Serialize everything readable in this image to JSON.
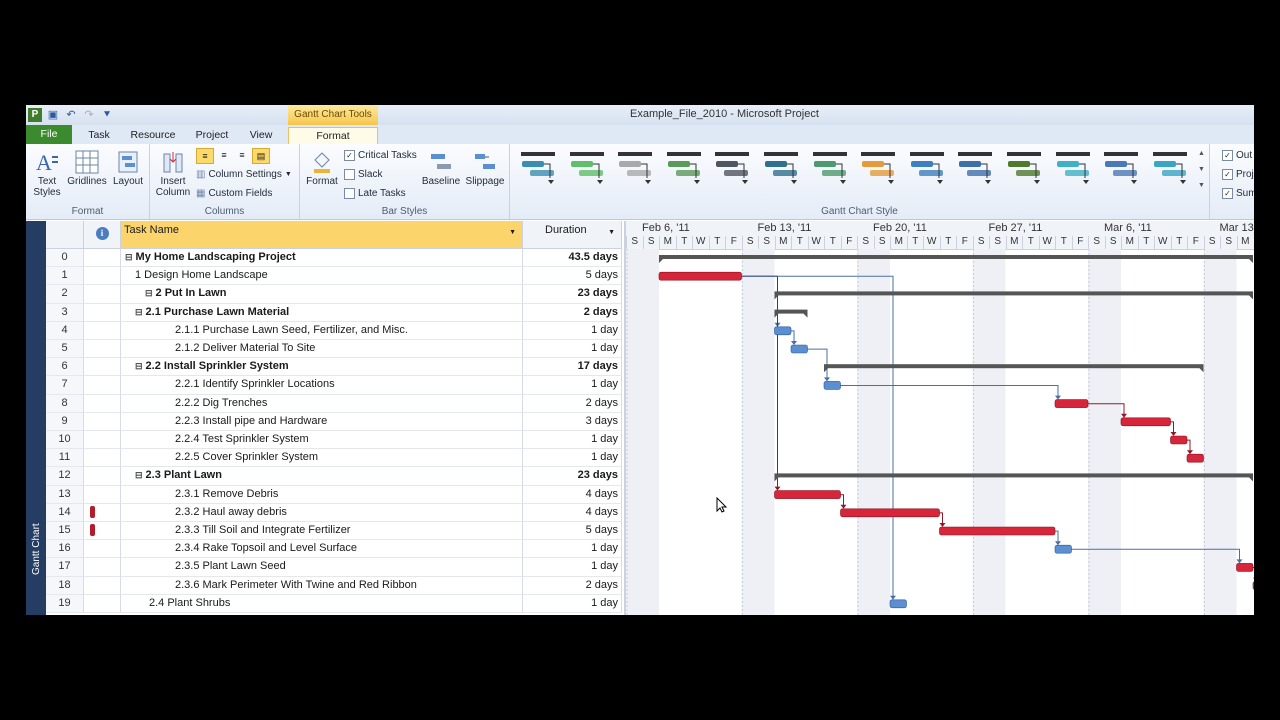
{
  "window": {
    "title": "Example_File_2010  -  Microsoft Project",
    "context_tab_title": "Gantt Chart Tools"
  },
  "quick_access": {
    "logo": "P",
    "icons": [
      "save-icon",
      "undo-icon",
      "redo-icon",
      "customize-icon"
    ]
  },
  "tabs": [
    {
      "label": "File"
    },
    {
      "label": "Task"
    },
    {
      "label": "Resource"
    },
    {
      "label": "Project"
    },
    {
      "label": "View"
    },
    {
      "label": "Format"
    }
  ],
  "ribbon": {
    "format_group": {
      "label": "Format",
      "text_styles": "Text\nStyles",
      "gridlines": "Gridlines",
      "layout": "Layout"
    },
    "columns_group": {
      "label": "Columns",
      "insert_column": "Insert\nColumn",
      "column_settings": "Column Settings",
      "custom_fields": "Custom Fields"
    },
    "bar_styles_group": {
      "label": "Bar Styles",
      "format": "Format",
      "critical_tasks": "Critical Tasks",
      "slack": "Slack",
      "late_tasks": "Late Tasks",
      "baseline": "Baseline",
      "slippage": "Slippage"
    },
    "gantt_style_group": {
      "label": "Gantt Chart Style"
    },
    "show_hide": {
      "outline": "Out",
      "project": "Proj",
      "summary": "Sum"
    }
  },
  "gantt_styles": [
    "#3a8fb0",
    "#5fbf6a",
    "#a9a9a9",
    "#5a9a5a",
    "#4f5561",
    "#2f6f8f",
    "#4c9a6e",
    "#e69b3a",
    "#3d7fbf",
    "#3f6faa",
    "#4e7a2e",
    "#3fb1c6",
    "#4a78b8",
    "#3aa5c6"
  ],
  "table": {
    "headers": {
      "id": "",
      "indicator": "i",
      "task_name": "Task Name",
      "duration": "Duration"
    },
    "rows": [
      {
        "id": "0",
        "name": "My Home Landscaping Project",
        "duration": "43.5 days",
        "level": 0,
        "summary": true,
        "toggle": "⊟"
      },
      {
        "id": "1",
        "name": "1 Design Home Landscape",
        "duration": "5 days",
        "level": 1,
        "summary": false
      },
      {
        "id": "2",
        "name": "2 Put In Lawn",
        "duration": "23 days",
        "level": 1,
        "summary": true,
        "toggle": "⊟"
      },
      {
        "id": "3",
        "name": "2.1 Purchase Lawn Material",
        "duration": "2 days",
        "level": 2,
        "summary": true,
        "toggle": "⊟"
      },
      {
        "id": "4",
        "name": "2.1.1 Purchase Lawn Seed,  Fertilizer, and Misc.",
        "duration": "1 day",
        "level": 3,
        "summary": false
      },
      {
        "id": "5",
        "name": "2.1.2 Deliver Material To Site",
        "duration": "1 day",
        "level": 3,
        "summary": false
      },
      {
        "id": "6",
        "name": "2.2 Install Sprinkler System",
        "duration": "17 days",
        "level": 2,
        "summary": true,
        "toggle": "⊟"
      },
      {
        "id": "7",
        "name": "2.2.1 Identify Sprinkler Locations",
        "duration": "1 day",
        "level": 3,
        "summary": false
      },
      {
        "id": "8",
        "name": "2.2.2 Dig Trenches",
        "duration": "2 days",
        "level": 3,
        "summary": false
      },
      {
        "id": "9",
        "name": "2.2.3 Install pipe and Hardware",
        "duration": "3 days",
        "level": 3,
        "summary": false
      },
      {
        "id": "10",
        "name": "2.2.4 Test Sprinkler System",
        "duration": "1 day",
        "level": 3,
        "summary": false
      },
      {
        "id": "11",
        "name": "2.2.5 Cover Sprinkler System",
        "duration": "1 day",
        "level": 3,
        "summary": false
      },
      {
        "id": "12",
        "name": "2.3 Plant Lawn",
        "duration": "23 days",
        "level": 2,
        "summary": true,
        "toggle": "⊟"
      },
      {
        "id": "13",
        "name": "2.3.1 Remove Debris",
        "duration": "4 days",
        "level": 3,
        "summary": false
      },
      {
        "id": "14",
        "name": "2.3.2 Haul away debris",
        "duration": "4 days",
        "level": 3,
        "summary": false,
        "indicator": "person"
      },
      {
        "id": "15",
        "name": "2.3.3 Till Soil and Integrate Fertilizer",
        "duration": "5 days",
        "level": 3,
        "summary": false,
        "indicator": "person"
      },
      {
        "id": "16",
        "name": "2.3.4 Rake Topsoil and Level Surface",
        "duration": "1 day",
        "level": 3,
        "summary": false
      },
      {
        "id": "17",
        "name": "2.3.5 Plant Lawn Seed",
        "duration": "1 day",
        "level": 3,
        "summary": false
      },
      {
        "id": "18",
        "name": "2.3.6 Mark Perimeter With Twine and Red Ribbon",
        "duration": "2 days",
        "level": 3,
        "summary": false
      },
      {
        "id": "19",
        "name": "2.4 Plant Shrubs",
        "duration": "1 day",
        "level": 2,
        "summary": false
      }
    ]
  },
  "timescale": {
    "weeks": [
      "Feb 6, '11",
      "Feb 13, '11",
      "Feb 20, '11",
      "Feb 27, '11",
      "Mar 6, '11",
      "Mar 13"
    ],
    "days": [
      "S",
      "S",
      "M",
      "T",
      "W",
      "T",
      "F",
      "S",
      "S",
      "M",
      "T",
      "W",
      "T",
      "F",
      "S",
      "S",
      "M",
      "T",
      "W",
      "T",
      "F",
      "S",
      "S",
      "M",
      "T",
      "W",
      "T",
      "F",
      "S",
      "S",
      "M",
      "T",
      "W",
      "T",
      "F",
      "S",
      "S",
      "M"
    ]
  },
  "bars": [
    {
      "row": 0,
      "type": "summary",
      "start": 2,
      "end": 38
    },
    {
      "row": 1,
      "type": "critical",
      "start": 2,
      "end": 7
    },
    {
      "row": 2,
      "type": "summary",
      "start": 9,
      "end": 38
    },
    {
      "row": 3,
      "type": "summary",
      "start": 9,
      "end": 11
    },
    {
      "row": 4,
      "type": "normal",
      "start": 9,
      "end": 10
    },
    {
      "row": 5,
      "type": "normal",
      "start": 10,
      "end": 11
    },
    {
      "row": 6,
      "type": "summary",
      "start": 12,
      "end": 35
    },
    {
      "row": 7,
      "type": "normal",
      "start": 12,
      "end": 13
    },
    {
      "row": 8,
      "type": "critical",
      "start": 26,
      "end": 28
    },
    {
      "row": 9,
      "type": "critical",
      "start": 30,
      "end": 33
    },
    {
      "row": 10,
      "type": "critical",
      "start": 33,
      "end": 34
    },
    {
      "row": 11,
      "type": "critical",
      "start": 34,
      "end": 35
    },
    {
      "row": 12,
      "type": "summary",
      "start": 9,
      "end": 38
    },
    {
      "row": 13,
      "type": "critical",
      "start": 9,
      "end": 13
    },
    {
      "row": 14,
      "type": "critical",
      "start": 13,
      "end": 19
    },
    {
      "row": 15,
      "type": "critical",
      "start": 19,
      "end": 26
    },
    {
      "row": 16,
      "type": "normal",
      "start": 26,
      "end": 27
    },
    {
      "row": 17,
      "type": "critical",
      "start": 37,
      "end": 38
    },
    {
      "row": 18,
      "type": "critical",
      "start": 38,
      "end": 40
    },
    {
      "row": 19,
      "type": "normal",
      "start": 16,
      "end": 17
    }
  ],
  "colors": {
    "critical": "#d7263a",
    "normal": "#5b8fd1",
    "summary": "#555555",
    "link": "#8a1c2a",
    "link_normal": "#4a6fa5",
    "weekend": "#eef0f6"
  }
}
